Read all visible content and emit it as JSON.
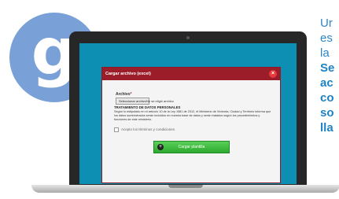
{
  "logo": {
    "letter": "g"
  },
  "side_text": {
    "line1": "Ur",
    "line2": "es",
    "line3": "la",
    "line4": "Se",
    "line5": "ac",
    "line6": "co",
    "line7": "so",
    "line8": "lla"
  },
  "dialog": {
    "title": "Cargar archivo (excel)",
    "close_glyph": "×",
    "field_label": "Archivo",
    "required_mark": "*",
    "file_button": "Seleccionar archivo",
    "file_status": "No se eligió archivo",
    "section_title": "TRATAMIENTO DE DATOS PERSONALES",
    "section_text": "Según lo estipulado en el artículo 10 de la Ley 1581 de 2012, el Ministerio de Vivienda, Ciudad y Territorio informa que los datos suministrados serán incluidos en nuestra base de datos y serán tratados según los procedimientos y funciones de este ministerio.",
    "checkbox_label": "Acepto los términos y condiciones",
    "upload_button": "Cargar plantilla",
    "upload_icon_glyph": "+"
  },
  "colors": {
    "logo_bg": "#7aa0d8",
    "screen_bg": "#0c8fb3",
    "dialog_header": "#9b1d29",
    "upload_button": "#2da82d"
  }
}
